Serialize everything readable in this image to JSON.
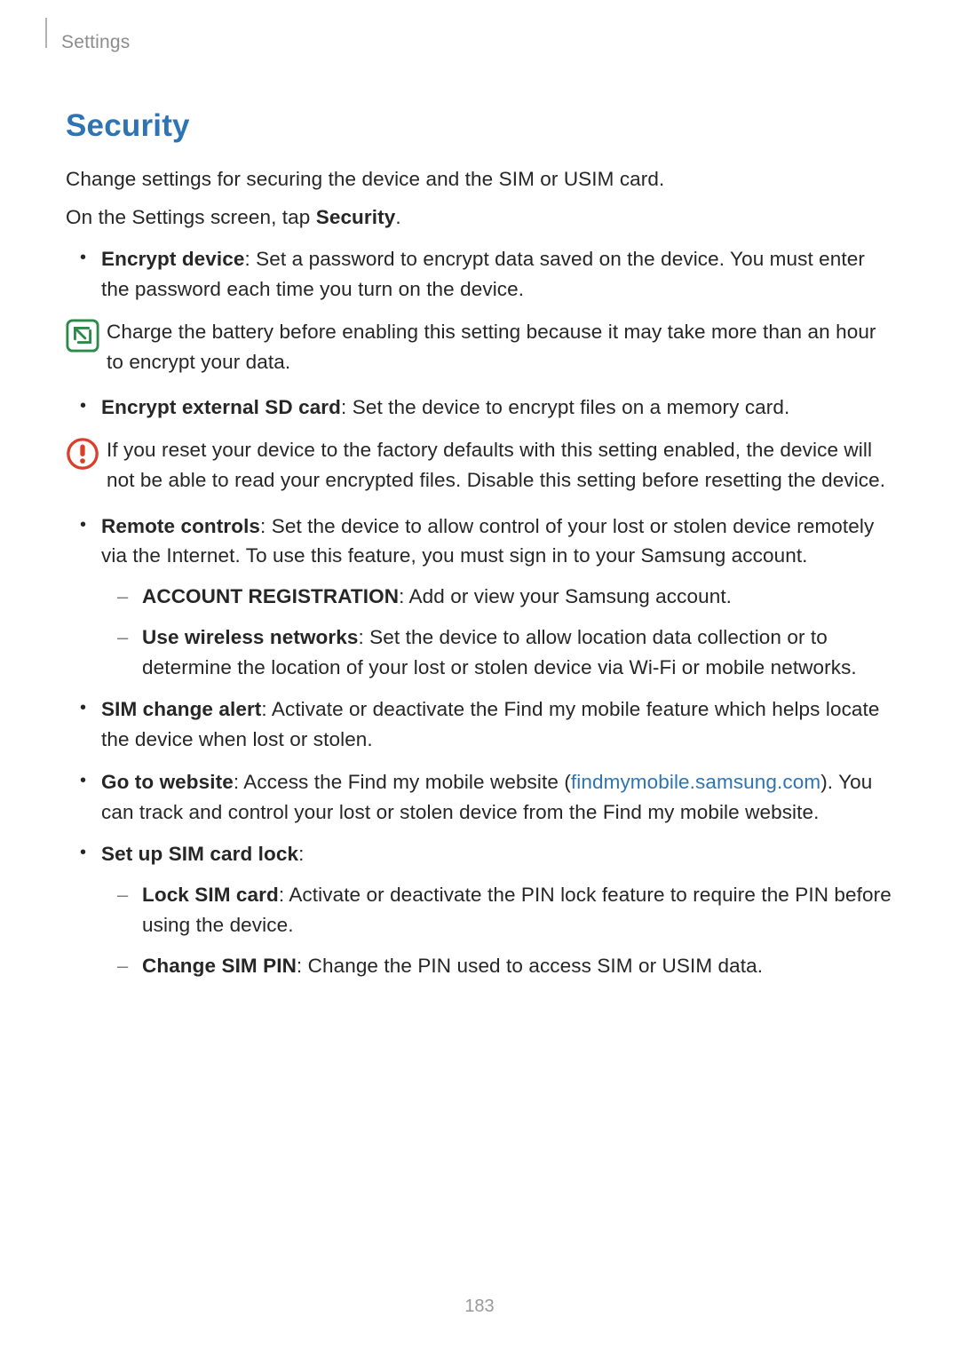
{
  "breadcrumb": "Settings",
  "section_title": "Security",
  "intro1": "Change settings for securing the device and the SIM or USIM card.",
  "intro2_prefix": "On the Settings screen, tap ",
  "intro2_bold": "Security",
  "intro2_suffix": ".",
  "items": {
    "encrypt_device_label": "Encrypt device",
    "encrypt_device_text": ": Set a password to encrypt data saved on the device. You must enter the password each time you turn on the device.",
    "note1": "Charge the battery before enabling this setting because it may take more than an hour to encrypt your data.",
    "encrypt_sd_label": "Encrypt external SD card",
    "encrypt_sd_text": ": Set the device to encrypt files on a memory card.",
    "warn1": "If you reset your device to the factory defaults with this setting enabled, the device will not be able to read your encrypted files. Disable this setting before resetting the device.",
    "remote_label": "Remote controls",
    "remote_text": ": Set the device to allow control of your lost or stolen device remotely via the Internet. To use this feature, you must sign in to your Samsung account.",
    "account_reg_label": "ACCOUNT REGISTRATION",
    "account_reg_text": ": Add or view your Samsung account.",
    "wireless_label": "Use wireless networks",
    "wireless_text": ": Set the device to allow location data collection or to determine the location of your lost or stolen device via Wi-Fi or mobile networks.",
    "sim_alert_label": "SIM change alert",
    "sim_alert_text": ": Activate or deactivate the Find my mobile feature which helps locate the device when lost or stolen.",
    "goto_label": "Go to website",
    "goto_prefix": ": Access the Find my mobile website (",
    "goto_link": "findmymobile.samsung.com",
    "goto_suffix": "). You can track and control your lost or stolen device from the Find my mobile website.",
    "simlock_label": "Set up SIM card lock",
    "simlock_suffix": ":",
    "lock_sim_label": "Lock SIM card",
    "lock_sim_text": ": Activate or deactivate the PIN lock feature to require the PIN before using the device.",
    "change_pin_label": "Change SIM PIN",
    "change_pin_text": ": Change the PIN used to access SIM or USIM data."
  },
  "page_number": "183"
}
